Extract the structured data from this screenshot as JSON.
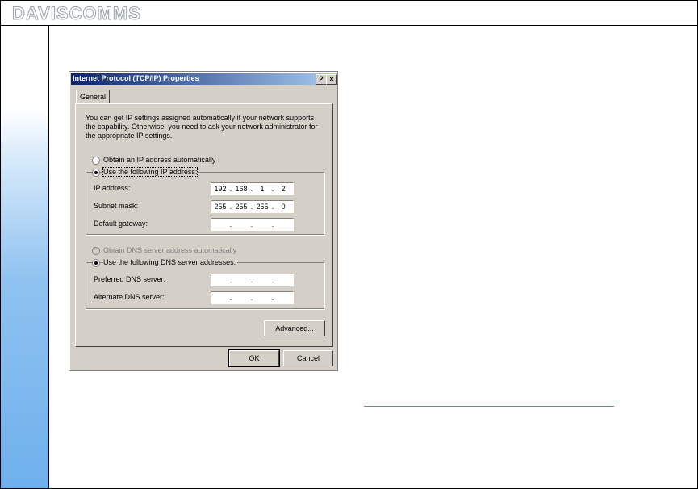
{
  "slide": {
    "logo": "DAVISCOMMS"
  },
  "dialog": {
    "title": "Internet Protocol (TCP/IP) Properties",
    "help_btn": "?",
    "close_btn": "×",
    "tab_general": "General",
    "intro": "You can get IP settings assigned automatically if your network supports the capability. Otherwise, you need to ask your network administrator for the appropriate IP settings.",
    "ip_auto_label": "Obtain an IP address automatically",
    "ip_manual_label": "Use the following IP address:",
    "ip_mode": "manual",
    "ip_fields": [
      {
        "label": "IP address:",
        "octets": [
          "192",
          "168",
          "1",
          "2"
        ]
      },
      {
        "label": "Subnet mask:",
        "octets": [
          "255",
          "255",
          "255",
          "0"
        ]
      },
      {
        "label": "Default gateway:",
        "octets": [
          "",
          "",
          "",
          ""
        ]
      }
    ],
    "dns_auto_label": "Obtain DNS server address automatically",
    "dns_manual_label": "Use the following DNS server addresses:",
    "dns_mode": "manual",
    "dns_fields": [
      {
        "label": "Preferred DNS server:",
        "octets": [
          "",
          "",
          "",
          ""
        ]
      },
      {
        "label": "Alternate DNS server:",
        "octets": [
          "",
          "",
          "",
          ""
        ]
      }
    ],
    "advanced_btn": "Advanced...",
    "ok_btn": "OK",
    "cancel_btn": "Cancel"
  }
}
